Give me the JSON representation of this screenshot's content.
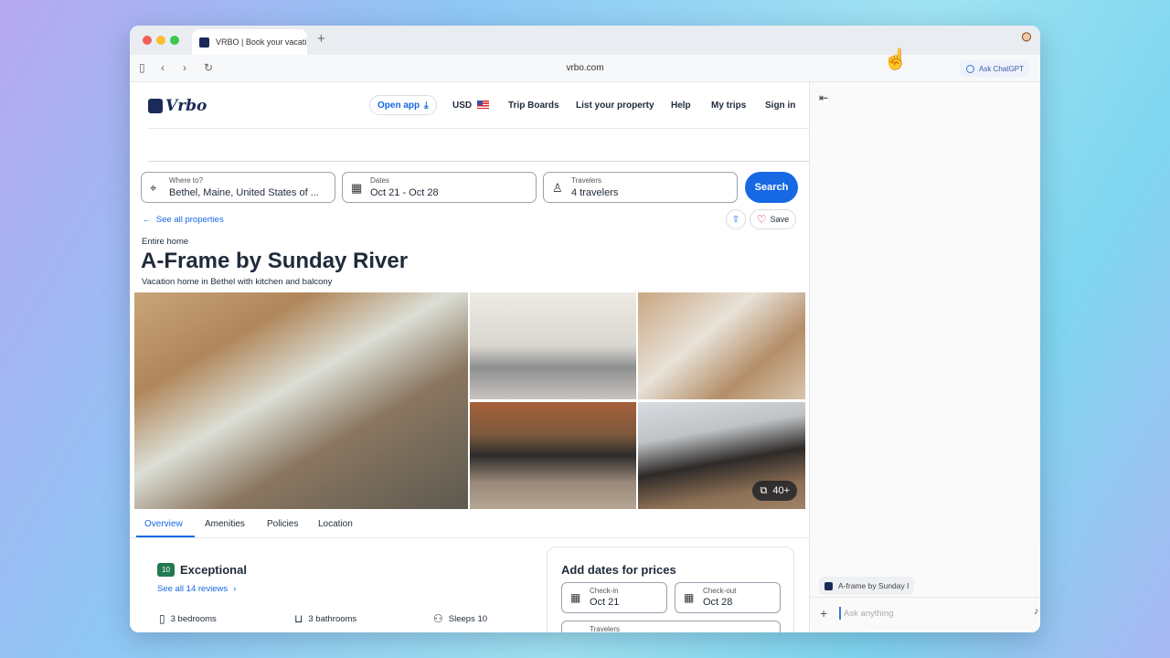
{
  "browser": {
    "tab_title": "VRBO | Book your vacati",
    "new_tab_label": "+",
    "url": "vrbo.com",
    "ask_button": "Ask ChatGPT"
  },
  "header": {
    "logo_text": "Vrbo",
    "open_app": "Open app",
    "currency": "USD",
    "nav": [
      "Trip Boards",
      "List your property",
      "Help",
      "My trips",
      "Sign in"
    ]
  },
  "search": {
    "where_label": "Where to?",
    "where_value": "Bethel, Maine, United States of ...",
    "dates_label": "Dates",
    "dates_value": "Oct 21 - Oct 28",
    "travelers_label": "Travelers",
    "travelers_value": "4 travelers",
    "search_button": "Search"
  },
  "property": {
    "see_all": "See all properties",
    "save": "Save",
    "type": "Entire home",
    "title": "A-Frame by Sunday River",
    "subtitle": "Vacation home in Bethel with kitchen and balcony",
    "photo_count": "40+"
  },
  "tabs": [
    "Overview",
    "Amenities",
    "Policies",
    "Location"
  ],
  "rating": {
    "score": "10",
    "label": "Exceptional",
    "reviews_link": "See all 14 reviews"
  },
  "features": [
    "3 bedrooms",
    "3 bathrooms",
    "Sleeps 10"
  ],
  "price_card": {
    "title": "Add dates for prices",
    "checkin_label": "Check-in",
    "checkin_value": "Oct 21",
    "checkout_label": "Check-out",
    "checkout_value": "Oct 28",
    "travelers_label": "Travelers"
  },
  "side_panel": {
    "context_chip": "A-frame by Sunday I",
    "input_placeholder": "Ask anything"
  },
  "colors": {
    "brand_navy": "#1a2a5a",
    "link_blue": "#1668e3",
    "rating_green": "#227950"
  }
}
